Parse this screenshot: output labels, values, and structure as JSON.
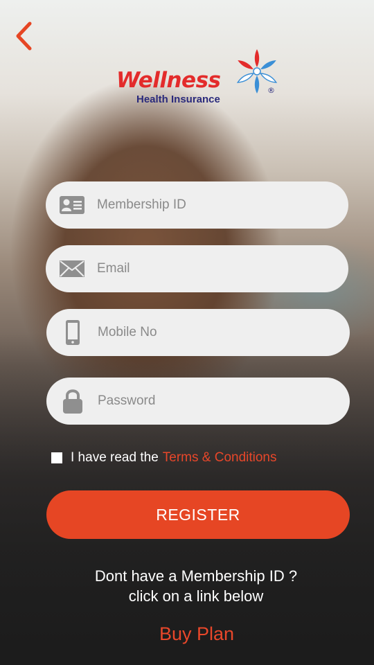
{
  "logo": {
    "brand": "Wellness",
    "subtitle": "Health Insurance",
    "mark": "®"
  },
  "form": {
    "membership_placeholder": "Membership ID",
    "email_placeholder": "Email",
    "mobile_placeholder": "Mobile No",
    "password_placeholder": "Password"
  },
  "terms": {
    "text": "I have read the",
    "link": "Terms & Conditions",
    "checked": false
  },
  "register_label": "REGISTER",
  "info": {
    "line1": "Dont have a Membership ID ?",
    "line2": "click on a link below"
  },
  "buy_plan_label": "Buy Plan",
  "icons": {
    "back": "chevron-left-icon",
    "membership": "id-card-icon",
    "email": "envelope-icon",
    "mobile": "phone-icon",
    "password": "lock-icon"
  },
  "colors": {
    "accent": "#e64624",
    "link": "#e8472a",
    "brand_red": "#e32b2b",
    "brand_blue": "#2a2a7c",
    "field_bg": "#efefef",
    "icon_gray": "#8f8f8f"
  }
}
